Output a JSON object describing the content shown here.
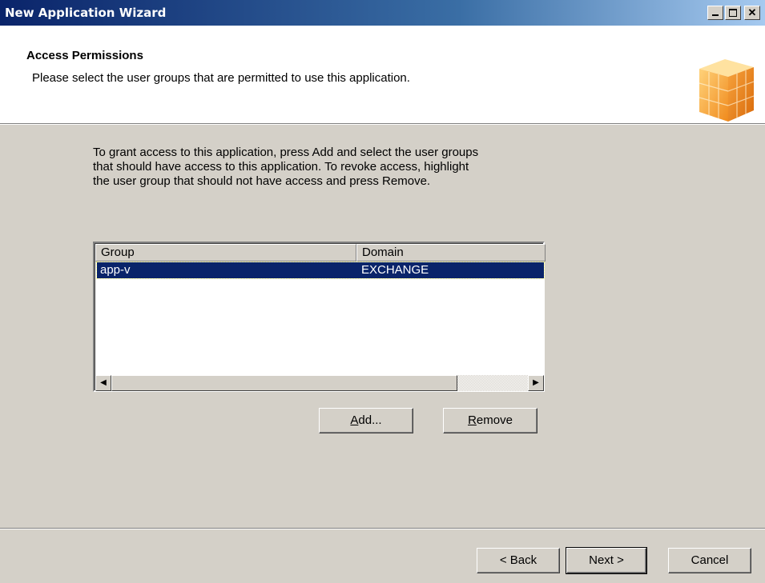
{
  "window": {
    "title": "New Application Wizard",
    "controls": [
      "minimize-icon",
      "maximize-icon",
      "close-icon"
    ]
  },
  "header": {
    "title": "Access Permissions",
    "subtitle": "Please select the user groups that are permitted to use this application.",
    "icon": "cube-icon"
  },
  "instructions": "To grant access to this application, press Add and select the user groups\nthat should have access to this application.  To revoke access, highlight\nthe user group that should not have access and press Remove.",
  "groups_table": {
    "columns": [
      "Group",
      "Domain"
    ],
    "rows": [
      {
        "group": "app-v",
        "domain": "EXCHANGE",
        "selected": true
      }
    ]
  },
  "buttons": {
    "add_prefix": "",
    "add_accel": "A",
    "add_rest": "dd...",
    "remove_accel": "R",
    "remove_rest": "emove",
    "back": "< Back",
    "next": "Next >",
    "cancel": "Cancel"
  },
  "colors": {
    "titlebar_start": "#0a246a",
    "titlebar_end": "#a6caf0",
    "selection": "#0a246a",
    "dialog_bg": "#d4d0c8",
    "cube": "#f5a43b"
  }
}
